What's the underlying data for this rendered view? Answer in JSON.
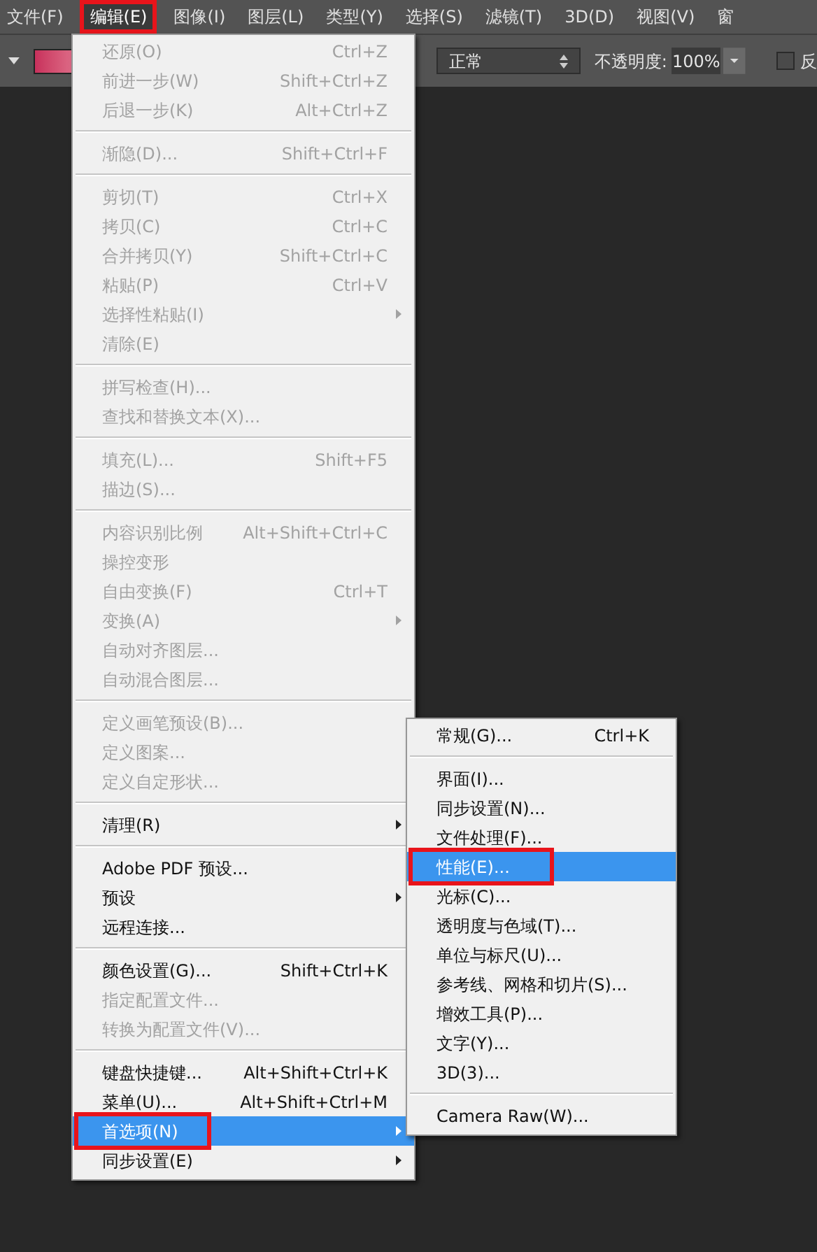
{
  "menubar": [
    {
      "label": "文件(F)",
      "selected": false,
      "annotated": false
    },
    {
      "label": "编辑(E)",
      "selected": true,
      "annotated": true
    },
    {
      "label": "图像(I)",
      "selected": false,
      "annotated": false
    },
    {
      "label": "图层(L)",
      "selected": false,
      "annotated": false
    },
    {
      "label": "类型(Y)",
      "selected": false,
      "annotated": false
    },
    {
      "label": "选择(S)",
      "selected": false,
      "annotated": false
    },
    {
      "label": "滤镜(T)",
      "selected": false,
      "annotated": false
    },
    {
      "label": "3D(D)",
      "selected": false,
      "annotated": false
    },
    {
      "label": "视图(V)",
      "selected": false,
      "annotated": false
    },
    {
      "label": "窗",
      "selected": false,
      "annotated": false
    }
  ],
  "options_bar": {
    "blend_mode": "正常",
    "opacity_label": "不透明度:",
    "opacity_value": "100%",
    "checkbox": {
      "checked": false,
      "label": "反"
    }
  },
  "edit_menu": {
    "groups": [
      [
        {
          "label": "还原(O)",
          "shortcut": "Ctrl+Z",
          "disabled": true,
          "has_submenu": false,
          "selected": false,
          "annotated": false
        },
        {
          "label": "前进一步(W)",
          "shortcut": "Shift+Ctrl+Z",
          "disabled": true,
          "has_submenu": false,
          "selected": false,
          "annotated": false
        },
        {
          "label": "后退一步(K)",
          "shortcut": "Alt+Ctrl+Z",
          "disabled": true,
          "has_submenu": false,
          "selected": false,
          "annotated": false
        }
      ],
      [
        {
          "label": "渐隐(D)...",
          "shortcut": "Shift+Ctrl+F",
          "disabled": true,
          "has_submenu": false,
          "selected": false,
          "annotated": false
        }
      ],
      [
        {
          "label": "剪切(T)",
          "shortcut": "Ctrl+X",
          "disabled": true,
          "has_submenu": false,
          "selected": false,
          "annotated": false
        },
        {
          "label": "拷贝(C)",
          "shortcut": "Ctrl+C",
          "disabled": true,
          "has_submenu": false,
          "selected": false,
          "annotated": false
        },
        {
          "label": "合并拷贝(Y)",
          "shortcut": "Shift+Ctrl+C",
          "disabled": true,
          "has_submenu": false,
          "selected": false,
          "annotated": false
        },
        {
          "label": "粘贴(P)",
          "shortcut": "Ctrl+V",
          "disabled": true,
          "has_submenu": false,
          "selected": false,
          "annotated": false
        },
        {
          "label": "选择性粘贴(I)",
          "disabled": true,
          "has_submenu": true,
          "selected": false,
          "annotated": false
        },
        {
          "label": "清除(E)",
          "disabled": true,
          "has_submenu": false,
          "selected": false,
          "annotated": false
        }
      ],
      [
        {
          "label": "拼写检查(H)...",
          "disabled": true,
          "has_submenu": false,
          "selected": false,
          "annotated": false
        },
        {
          "label": "查找和替换文本(X)...",
          "disabled": true,
          "has_submenu": false,
          "selected": false,
          "annotated": false
        }
      ],
      [
        {
          "label": "填充(L)...",
          "shortcut": "Shift+F5",
          "disabled": true,
          "has_submenu": false,
          "selected": false,
          "annotated": false
        },
        {
          "label": "描边(S)...",
          "disabled": true,
          "has_submenu": false,
          "selected": false,
          "annotated": false
        }
      ],
      [
        {
          "label": "内容识别比例",
          "shortcut": "Alt+Shift+Ctrl+C",
          "disabled": true,
          "has_submenu": false,
          "selected": false,
          "annotated": false
        },
        {
          "label": "操控变形",
          "disabled": true,
          "has_submenu": false,
          "selected": false,
          "annotated": false
        },
        {
          "label": "自由变换(F)",
          "shortcut": "Ctrl+T",
          "disabled": true,
          "has_submenu": false,
          "selected": false,
          "annotated": false
        },
        {
          "label": "变换(A)",
          "disabled": true,
          "has_submenu": true,
          "selected": false,
          "annotated": false
        },
        {
          "label": "自动对齐图层...",
          "disabled": true,
          "has_submenu": false,
          "selected": false,
          "annotated": false
        },
        {
          "label": "自动混合图层...",
          "disabled": true,
          "has_submenu": false,
          "selected": false,
          "annotated": false
        }
      ],
      [
        {
          "label": "定义画笔预设(B)...",
          "disabled": true,
          "has_submenu": false,
          "selected": false,
          "annotated": false
        },
        {
          "label": "定义图案...",
          "disabled": true,
          "has_submenu": false,
          "selected": false,
          "annotated": false
        },
        {
          "label": "定义自定形状...",
          "disabled": true,
          "has_submenu": false,
          "selected": false,
          "annotated": false
        }
      ],
      [
        {
          "label": "清理(R)",
          "disabled": false,
          "has_submenu": true,
          "selected": false,
          "annotated": false
        }
      ],
      [
        {
          "label": "Adobe PDF 预设...",
          "disabled": false,
          "has_submenu": false,
          "selected": false,
          "annotated": false
        },
        {
          "label": "预设",
          "disabled": false,
          "has_submenu": true,
          "selected": false,
          "annotated": false
        },
        {
          "label": "远程连接...",
          "disabled": false,
          "has_submenu": false,
          "selected": false,
          "annotated": false
        }
      ],
      [
        {
          "label": "颜色设置(G)...",
          "shortcut": "Shift+Ctrl+K",
          "disabled": false,
          "has_submenu": false,
          "selected": false,
          "annotated": false
        },
        {
          "label": "指定配置文件...",
          "disabled": true,
          "has_submenu": false,
          "selected": false,
          "annotated": false
        },
        {
          "label": "转换为配置文件(V)...",
          "disabled": true,
          "has_submenu": false,
          "selected": false,
          "annotated": false
        }
      ],
      [
        {
          "label": "键盘快捷键...",
          "shortcut": "Alt+Shift+Ctrl+K",
          "disabled": false,
          "has_submenu": false,
          "selected": false,
          "annotated": false
        },
        {
          "label": "菜单(U)...",
          "shortcut": "Alt+Shift+Ctrl+M",
          "disabled": false,
          "has_submenu": false,
          "selected": false,
          "annotated": false
        },
        {
          "label": "首选项(N)",
          "disabled": false,
          "has_submenu": true,
          "selected": true,
          "annotated": true
        },
        {
          "label": "同步设置(E)",
          "disabled": false,
          "has_submenu": true,
          "selected": false,
          "annotated": false
        }
      ]
    ]
  },
  "preferences_submenu": {
    "groups": [
      [
        {
          "label": "常规(G)...",
          "shortcut": "Ctrl+K",
          "disabled": false,
          "has_submenu": false,
          "selected": false,
          "annotated": false
        }
      ],
      [
        {
          "label": "界面(I)...",
          "disabled": false,
          "has_submenu": false,
          "selected": false,
          "annotated": false
        },
        {
          "label": "同步设置(N)...",
          "disabled": false,
          "has_submenu": false,
          "selected": false,
          "annotated": false
        },
        {
          "label": "文件处理(F)...",
          "disabled": false,
          "has_submenu": false,
          "selected": false,
          "annotated": false
        },
        {
          "label": "性能(E)...",
          "disabled": false,
          "has_submenu": false,
          "selected": true,
          "annotated": true
        },
        {
          "label": "光标(C)...",
          "disabled": false,
          "has_submenu": false,
          "selected": false,
          "annotated": false
        },
        {
          "label": "透明度与色域(T)...",
          "disabled": false,
          "has_submenu": false,
          "selected": false,
          "annotated": false
        },
        {
          "label": "单位与标尺(U)...",
          "disabled": false,
          "has_submenu": false,
          "selected": false,
          "annotated": false
        },
        {
          "label": "参考线、网格和切片(S)...",
          "disabled": false,
          "has_submenu": false,
          "selected": false,
          "annotated": false
        },
        {
          "label": "增效工具(P)...",
          "disabled": false,
          "has_submenu": false,
          "selected": false,
          "annotated": false
        },
        {
          "label": "文字(Y)...",
          "disabled": false,
          "has_submenu": false,
          "selected": false,
          "annotated": false
        },
        {
          "label": "3D(3)...",
          "disabled": false,
          "has_submenu": false,
          "selected": false,
          "annotated": false
        }
      ],
      [
        {
          "label": "Camera Raw(W)...",
          "disabled": false,
          "has_submenu": false,
          "selected": false,
          "annotated": false
        }
      ]
    ]
  }
}
